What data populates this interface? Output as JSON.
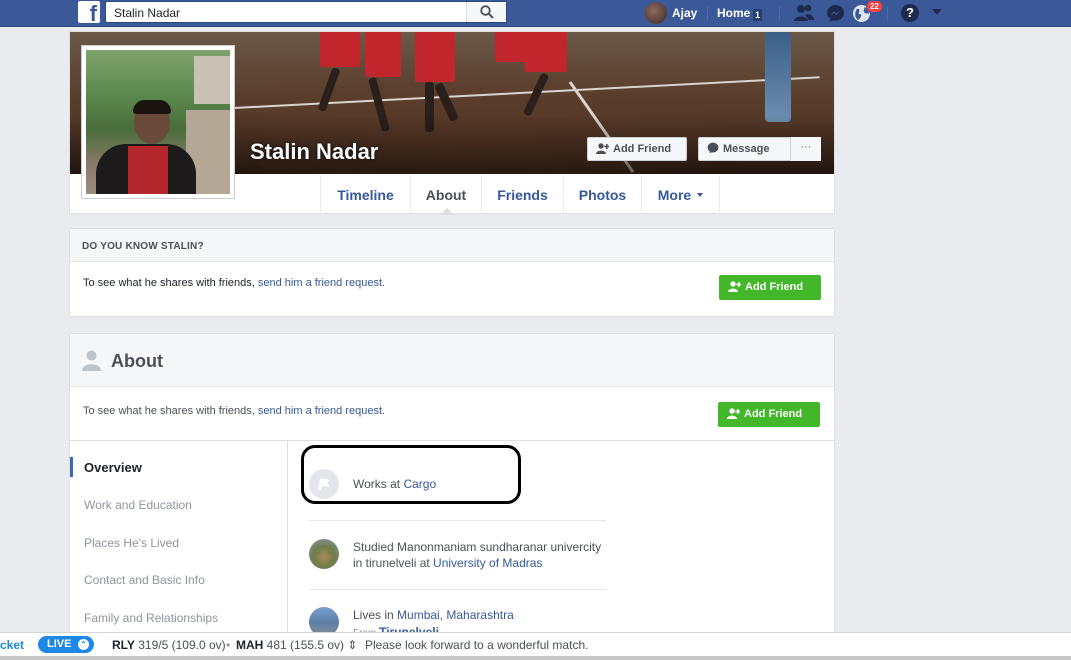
{
  "topbar": {
    "search_value": "Stalin Nadar",
    "user_name": "Ajay",
    "home_label": "Home",
    "home_badge": "1",
    "notifications_badge": "22",
    "help_label": "?"
  },
  "profile": {
    "name": "Stalin Nadar",
    "add_friend_label": "Add Friend",
    "message_label": "Message",
    "more_dots": "···",
    "tabs": [
      "Timeline",
      "About",
      "Friends",
      "Photos",
      "More"
    ]
  },
  "know_card": {
    "heading": "DO YOU KNOW STALIN?",
    "text": "To see what he shares with friends, ",
    "link": "send him a friend request.",
    "button": "Add Friend"
  },
  "about": {
    "title": "About",
    "sub_text": "To see what he shares with friends, ",
    "sub_link": "send him a friend request.",
    "button": "Add Friend",
    "nav": [
      "Overview",
      "Work and Education",
      "Places He's Lived",
      "Contact and Basic Info",
      "Family and Relationships"
    ],
    "items": [
      {
        "text": "Works at ",
        "link": "Cargo"
      },
      {
        "text": "Studied Manonmaniam sundharanar univercity in tirunelveli at ",
        "link": "University of Madras"
      },
      {
        "text": "Lives in ",
        "link": "Mumbai, Maharashtra",
        "from_label": "From ",
        "from_link": "Tirunelveli"
      }
    ]
  },
  "ticker": {
    "prefix": "cket",
    "live_label": "LIVE",
    "team1": "RLY",
    "score1": " 319/5 (109.0 ov)",
    "team2": "MAH",
    "score2": " 481 (155.5 ov) ⇕",
    "message": "Please look forward to a wonderful match."
  },
  "colors": {
    "brand_blue": "#3b5998",
    "link_blue": "#365899",
    "green": "#42b72a",
    "badge_red": "#fa3e3e",
    "live_blue": "#1e88e5"
  }
}
